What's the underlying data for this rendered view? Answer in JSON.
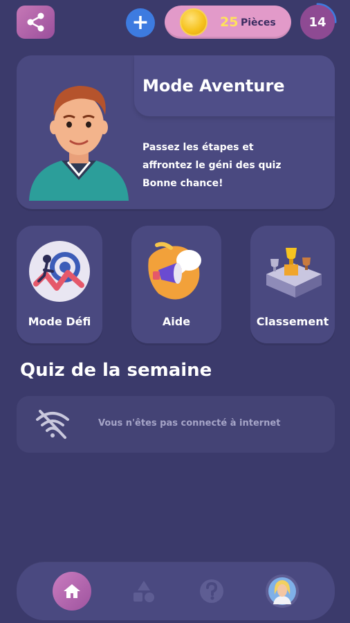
{
  "top_bar": {
    "share_icon": "share-icon",
    "add_icon": "plus-icon",
    "coins_count": "25",
    "coins_label": "Pièces",
    "level": "14"
  },
  "adventure": {
    "title": "Mode Aventure",
    "description_line1": "Passez les étapes et",
    "description_line2": "affrontez le géni des quiz",
    "description_line3": "Bonne chance!"
  },
  "modes": [
    {
      "label": "Mode Défi",
      "icon": "target-runner-icon"
    },
    {
      "label": "Aide",
      "icon": "megaphone-icon"
    },
    {
      "label": "Classement",
      "icon": "podium-trophy-icon"
    }
  ],
  "weekly_quiz": {
    "title": "Quiz de la semaine",
    "message": "Vous n'êtes pas connecté à internet",
    "icon": "wifi-off-icon"
  },
  "bottom_nav": {
    "items": [
      "home-icon",
      "shapes-icon",
      "help-icon",
      "profile-avatar"
    ],
    "active": "home-icon"
  },
  "colors": {
    "background": "#3b3a6b",
    "card": "#4a4980",
    "accent_pink": "#c678b6",
    "coin_gold": "#f6c320",
    "plus_blue": "#3d7be0"
  }
}
